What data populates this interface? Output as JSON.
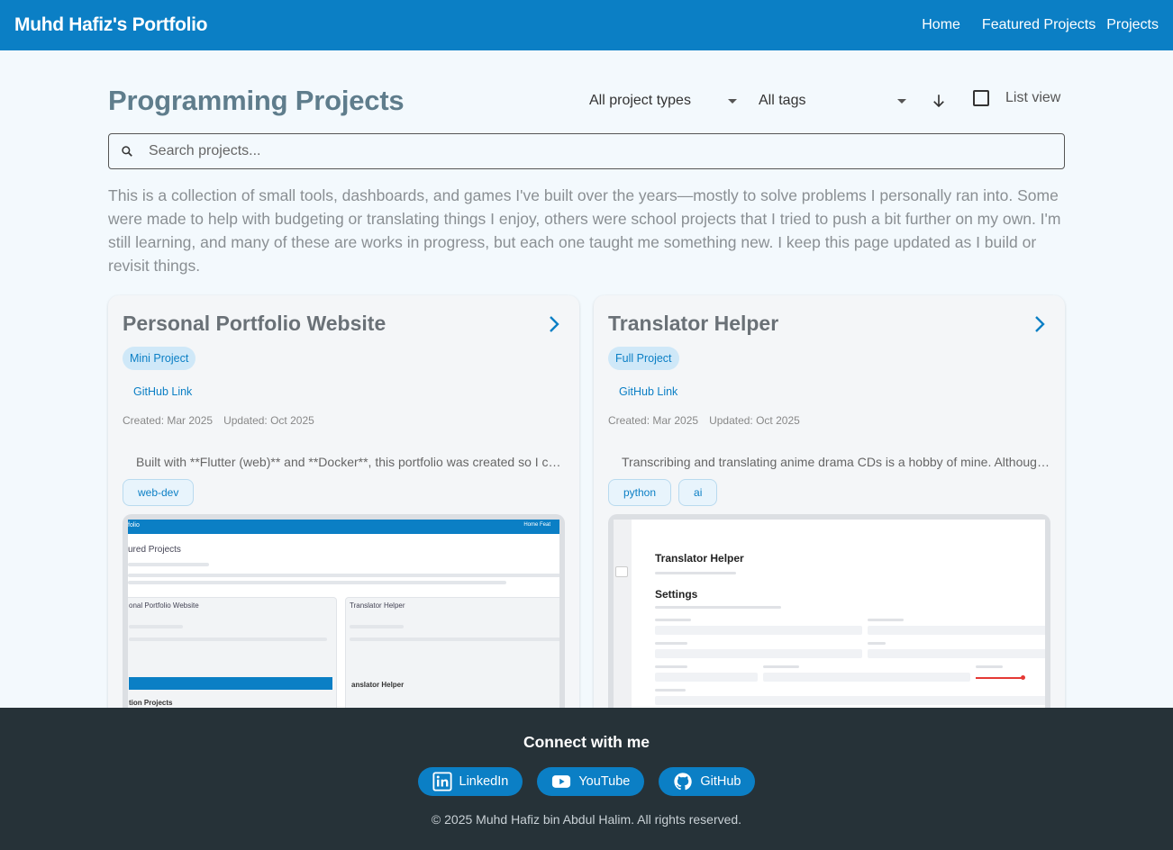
{
  "appbar": {
    "brand": "Muhd Hafiz's Portfolio",
    "nav": [
      "Home",
      "Featured Projects",
      "Projects"
    ]
  },
  "page": {
    "title": "Programming Projects",
    "filters": {
      "type_selected": "All project types",
      "tags_selected": "All tags",
      "list_view_label": "List view",
      "list_view_checked": false
    },
    "search": {
      "placeholder": "Search projects..."
    },
    "intro": "This is a collection of small tools, dashboards, and games I've built over the years—mostly to solve problems I personally ran into. Some were made to help with budgeting or translating things I enjoy, others were school projects that I tried to push a bit further on my own. I'm still learning, and many of these are works in progress, but each one taught me something new. I keep this page updated as I build or revisit things."
  },
  "projects": [
    {
      "title": "Personal Portfolio Website",
      "type": "Mini Project",
      "link_label": "GitHub Link",
      "created": "Created: Mar 2025",
      "updated": "Updated: Oct 2025",
      "description": "Built with **Flutter (web)** and **Docker**, this portfolio was created so I could showcase my projects.",
      "tags": [
        "web-dev"
      ],
      "thumb": {
        "bar_title": "folio",
        "bar_nav": "Home   Feat",
        "heading": "ured Projects",
        "card_a": "onal Portfolio Website",
        "card_b": "Translator Helper",
        "sub_a": "tion Projects",
        "sub_b": "anslator Helper"
      }
    },
    {
      "title": "Translator Helper",
      "type": "Full Project",
      "link_label": "GitHub Link",
      "created": "Created: Mar 2025",
      "updated": "Updated: Oct 2025",
      "description": "Transcribing and translating anime drama CDs is a hobby of mine. Although I'm still learning Japanese.",
      "tags": [
        "python",
        "ai"
      ],
      "thumb": {
        "heading": "Translator Helper",
        "settings": "Settings"
      }
    }
  ],
  "footer": {
    "heading": "Connect with me",
    "links": [
      "LinkedIn",
      "YouTube",
      "GitHub"
    ],
    "copyright": "© 2025 Muhd Hafiz bin Abdul Halim. All rights reserved."
  },
  "colors": {
    "primary": "#0b7fc5",
    "background": "#f3f9fd",
    "footer": "#263238"
  }
}
